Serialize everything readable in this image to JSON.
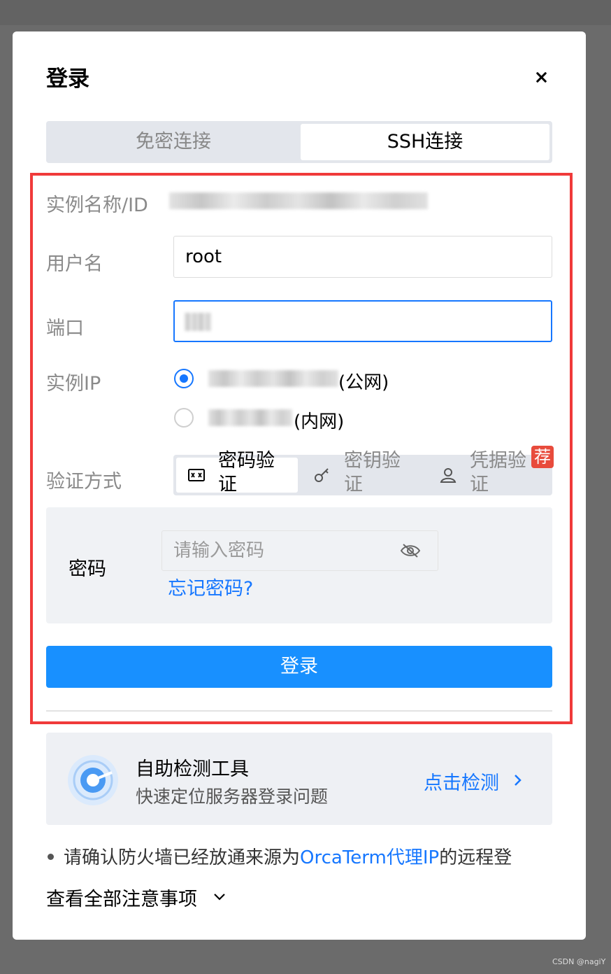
{
  "dialog": {
    "title": "登录",
    "close_label": "×"
  },
  "tabs": [
    {
      "label": "免密连接",
      "active": false
    },
    {
      "label": "SSH连接",
      "active": true
    }
  ],
  "form": {
    "instance_label": "实例名称/ID",
    "username_label": "用户名",
    "username_value": "root",
    "port_label": "端口",
    "ip_label": "实例IP",
    "public_suffix": "(公网)",
    "private_suffix": "(内网)",
    "auth_label": "验证方式",
    "auth_options": [
      {
        "label": "密码验证",
        "icon": "password-icon",
        "selected": true
      },
      {
        "label": "密钥验证",
        "icon": "key-icon",
        "selected": false
      },
      {
        "label": "凭据验证",
        "icon": "user-icon",
        "selected": false
      }
    ],
    "recommend_badge": "荐",
    "password_label": "密码",
    "password_placeholder": "请输入密码",
    "forgot_password": "忘记密码?",
    "login_button": "登录"
  },
  "diagnostic": {
    "title": "自助检测工具",
    "subtitle": "快速定位服务器登录问题",
    "link": "点击检测"
  },
  "notice": {
    "prefix": "请确认防火墙已经放通来源为",
    "link": "OrcaTerm代理IP",
    "suffix": "的远程登",
    "view_all": "查看全部注意事项"
  },
  "watermark": "CSDN @nagiY",
  "colors": {
    "accent": "#1677ff",
    "button": "#1890ff",
    "highlight_border": "#f03a3a",
    "badge": "#e84b3c"
  }
}
